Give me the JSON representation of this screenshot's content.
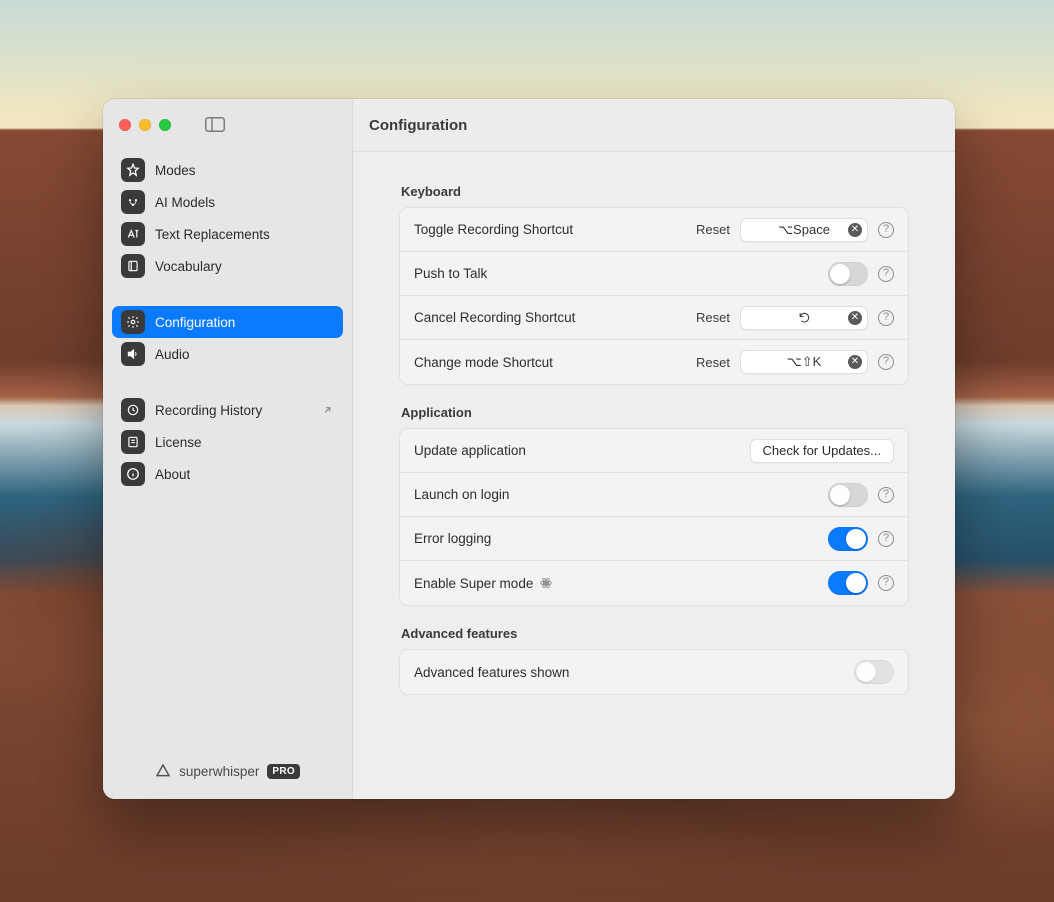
{
  "window": {
    "title": "Configuration"
  },
  "sidebar": {
    "items": [
      {
        "label": "Modes"
      },
      {
        "label": "AI Models"
      },
      {
        "label": "Text Replacements"
      },
      {
        "label": "Vocabulary"
      },
      {
        "label": "Configuration"
      },
      {
        "label": "Audio"
      },
      {
        "label": "Recording History"
      },
      {
        "label": "License"
      },
      {
        "label": "About"
      }
    ],
    "footer": {
      "brand": "superwhisper",
      "badge": "PRO"
    }
  },
  "sections": {
    "keyboard": {
      "title": "Keyboard",
      "toggle_recording_label": "Toggle Recording Shortcut",
      "toggle_recording_reset": "Reset",
      "toggle_recording_value": "⌥Space",
      "push_to_talk_label": "Push to Talk",
      "push_to_talk_on": false,
      "cancel_recording_label": "Cancel Recording Shortcut",
      "cancel_recording_reset": "Reset",
      "cancel_recording_value": "",
      "change_mode_label": "Change mode Shortcut",
      "change_mode_reset": "Reset",
      "change_mode_value": "⌥⇧K"
    },
    "application": {
      "title": "Application",
      "update_label": "Update application",
      "update_button": "Check for Updates...",
      "launch_label": "Launch on login",
      "launch_on": false,
      "error_label": "Error logging",
      "error_on": true,
      "super_label": "Enable Super mode",
      "super_on": true
    },
    "advanced": {
      "title": "Advanced features",
      "shown_label": "Advanced features shown",
      "shown_on": false
    }
  }
}
